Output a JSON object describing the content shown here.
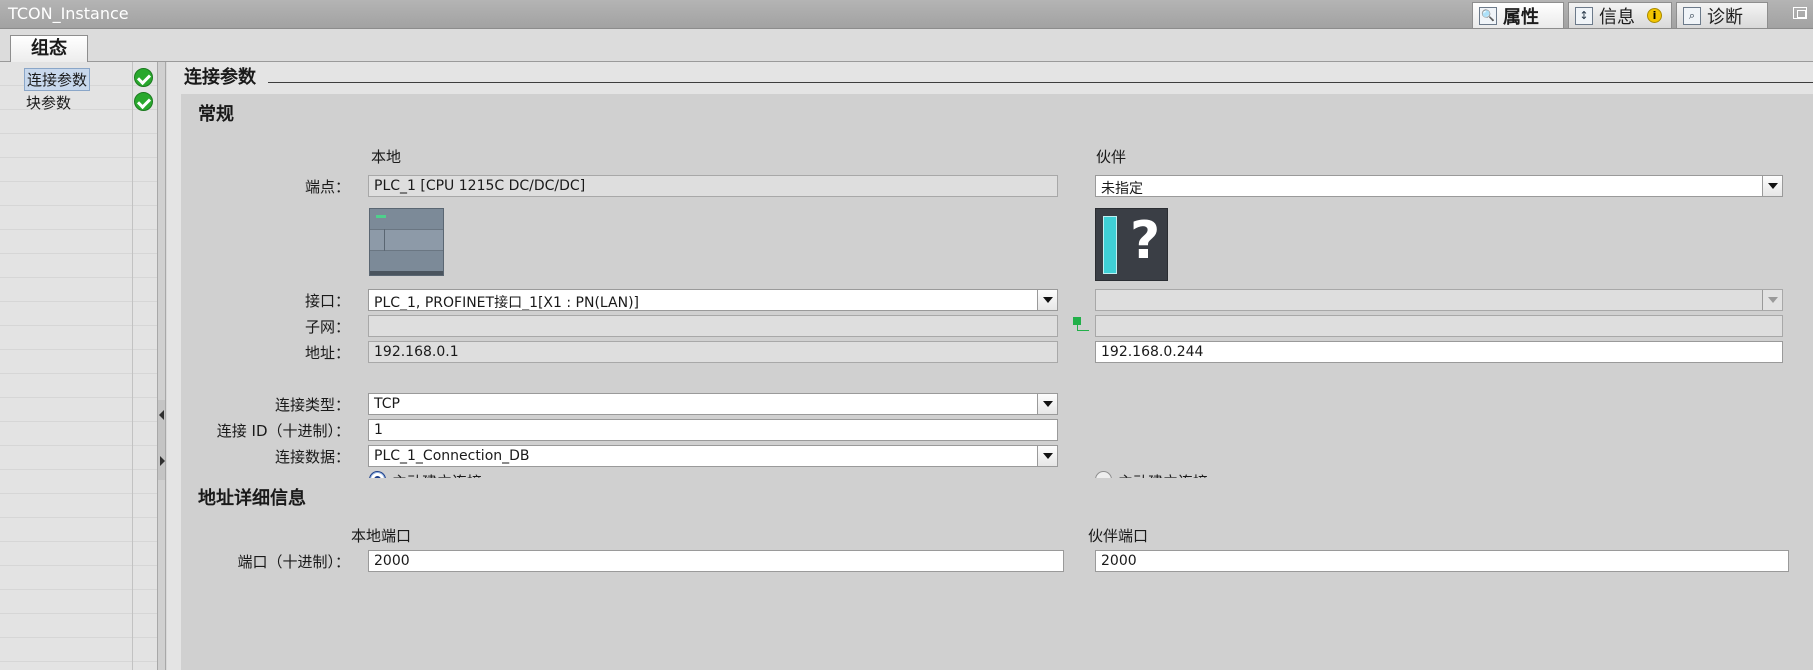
{
  "window": {
    "title": "TCON_Instance",
    "tabs": [
      {
        "label": "属性",
        "icon": "properties-icon"
      },
      {
        "label": "信息",
        "icon": "info-icon"
      },
      {
        "label": "诊断",
        "icon": "diagnostics-icon"
      }
    ]
  },
  "subtab": {
    "label": "组态"
  },
  "nav": {
    "items": [
      {
        "label": "连接参数",
        "status": "ok"
      },
      {
        "label": "块参数",
        "status": "ok"
      }
    ]
  },
  "main": {
    "section_title": "连接参数",
    "general": {
      "title": "常规",
      "local_header": "本地",
      "partner_header": "伙伴",
      "endpoint_label": "端点：",
      "local_endpoint": "PLC_1 [CPU 1215C DC/DC/DC]",
      "partner_endpoint": "未指定",
      "interface_label": "接口：",
      "local_interface": "PLC_1, PROFINET接口_1[X1 : PN(LAN)]",
      "partner_interface": "",
      "subnet_label": "子网：",
      "local_subnet": "",
      "partner_subnet": "",
      "address_label": "地址：",
      "local_address": "192.168.0.1",
      "partner_address": "192.168.0.244",
      "conn_type_label": "连接类型：",
      "conn_type": "TCP",
      "conn_id_label": "连接 ID（十进制）：",
      "conn_id": "1",
      "conn_data_label": "连接数据：",
      "conn_data": "PLC_1_Connection_DB",
      "local_active_label": "主动建立连接",
      "partner_active_label": "主动建立连接"
    },
    "address_details": {
      "title": "地址详细信息",
      "local_port_header": "本地端口",
      "partner_port_header": "伙伴端口",
      "port_label": "端口（十进制）：",
      "local_port": "2000",
      "partner_port": "2000"
    }
  }
}
